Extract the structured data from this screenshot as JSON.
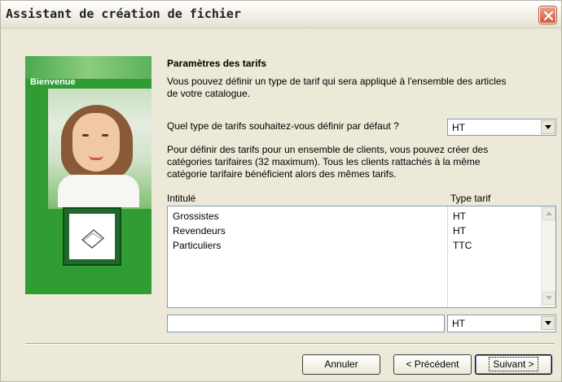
{
  "window": {
    "title": "Assistant de création de fichier",
    "close_icon": "close-icon"
  },
  "panel": {
    "label": "Bienvenue",
    "accent_color": "#2f9c34"
  },
  "content": {
    "heading": "Paramètres des tarifs",
    "intro_line1": "Vous pouvez définir un type de tarif qui sera appliqué à l'ensemble des articles",
    "intro_line2": "de votre catalogue.",
    "default_question": "Quel type de tarifs souhaitez-vous définir par défaut ?",
    "default_select_value": "HT",
    "categories_line1": "Pour définir des tarifs pour un ensemble de clients, vous pouvez créer des",
    "categories_line2": "catégories tarifaires (32 maximum). Tous les clients rattachés à la même",
    "categories_line3": "catégorie tarifaire bénéficient alors des mêmes tarifs."
  },
  "table": {
    "columns": [
      "Intitulé",
      "Type tarif"
    ],
    "rows": [
      {
        "name": "Grossistes",
        "type": "HT"
      },
      {
        "name": "Revendeurs",
        "type": "HT"
      },
      {
        "name": "Particuliers",
        "type": "TTC"
      }
    ]
  },
  "new_entry": {
    "name_value": "",
    "type_select_value": "HT"
  },
  "buttons": {
    "cancel": "Annuler",
    "previous": "< Précédent",
    "next": "Suivant >"
  }
}
